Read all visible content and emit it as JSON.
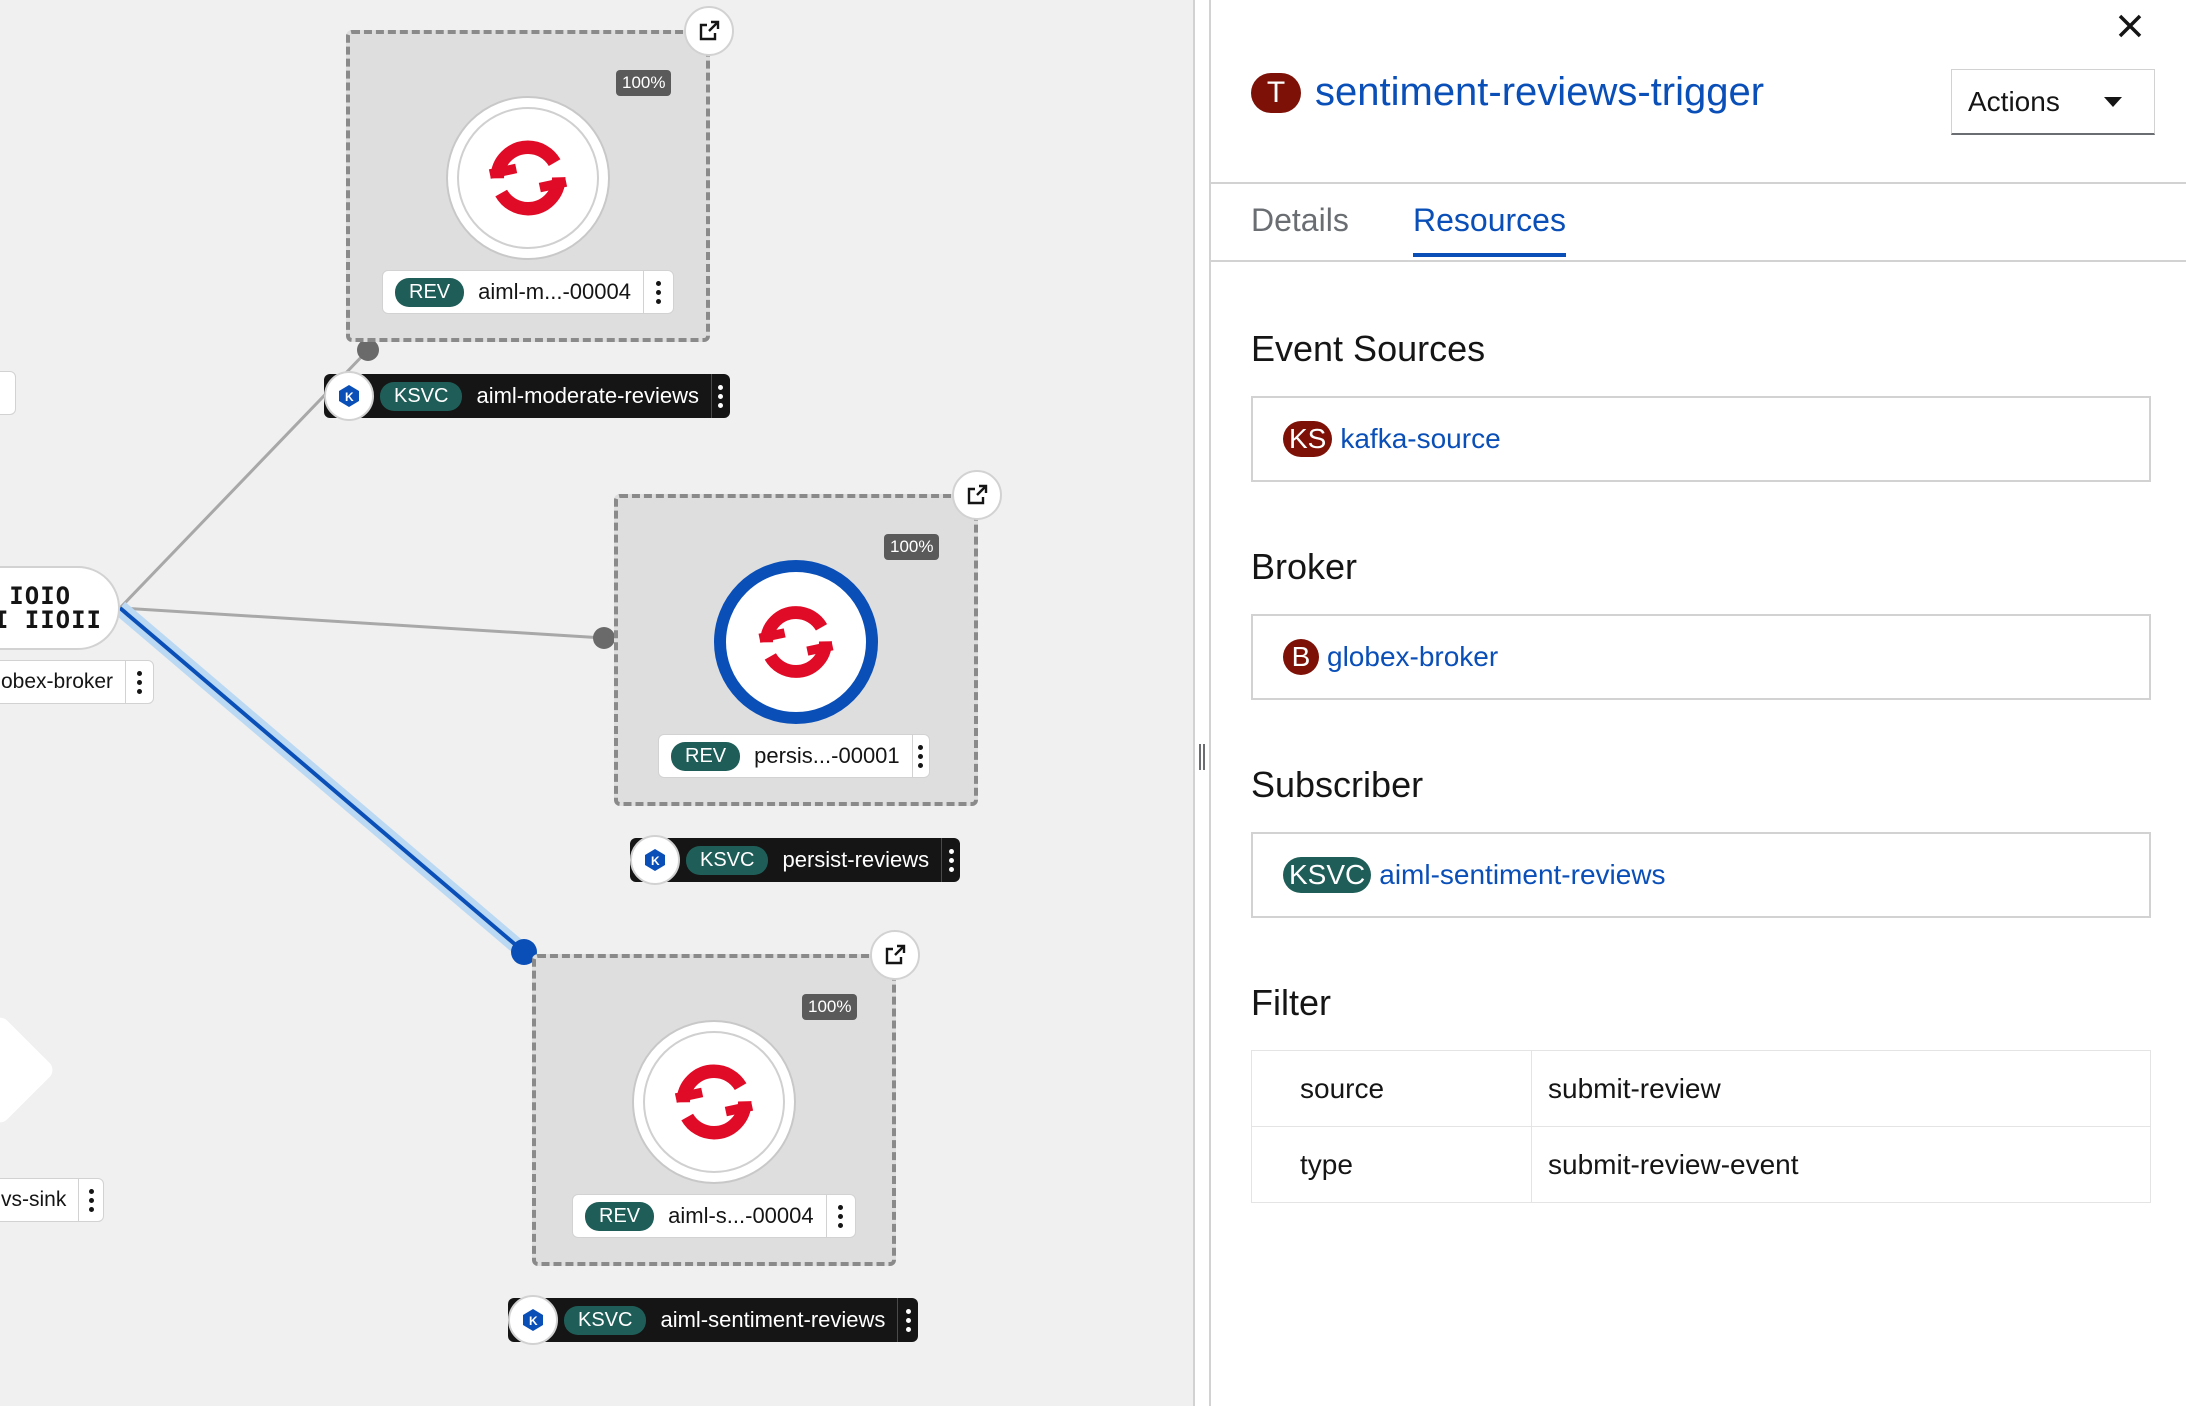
{
  "topology": {
    "groups": [
      {
        "id": "aiml-moderate",
        "traffic": "100%",
        "rev_tag": "REV",
        "rev_name": "aiml-m...-00004",
        "ksvc_tag": "KSVC",
        "ksvc_name": "aiml-moderate-reviews",
        "selected": false
      },
      {
        "id": "persist",
        "traffic": "100%",
        "rev_tag": "REV",
        "rev_name": "persis...-00001",
        "ksvc_tag": "KSVC",
        "ksvc_name": "persist-reviews",
        "selected": true
      },
      {
        "id": "aiml-sentiment",
        "traffic": "100%",
        "rev_tag": "REV",
        "rev_name": "aiml-s...-00004",
        "ksvc_tag": "KSVC",
        "ksvc_name": "aiml-sentiment-reviews",
        "selected": false
      }
    ],
    "broker": {
      "bits_top": "IO IOIO",
      "bits_bottom": "OII IIOII",
      "label": "obex-broker"
    },
    "sink": {
      "label": "vs-sink"
    },
    "colors": {
      "selected_edge": "#0a4fb8",
      "edge": "#a8a8a8",
      "revision_icon": "#e00b26"
    }
  },
  "panel": {
    "close_icon": "close-icon",
    "title_badge": "T",
    "title": "sentiment-reviews-trigger",
    "actions_label": "Actions",
    "tabs": [
      {
        "label": "Details",
        "active": false
      },
      {
        "label": "Resources",
        "active": true
      }
    ],
    "event_sources": {
      "heading": "Event Sources",
      "badge": "KS",
      "name": "kafka-source"
    },
    "broker": {
      "heading": "Broker",
      "badge": "B",
      "name": "globex-broker"
    },
    "subscriber": {
      "heading": "Subscriber",
      "badge": "KSVC",
      "name": "aiml-sentiment-reviews"
    },
    "filter": {
      "heading": "Filter",
      "rows": [
        {
          "key": "source",
          "value": "submit-review"
        },
        {
          "key": "type",
          "value": "submit-review-event"
        }
      ]
    },
    "colors": {
      "accent": "#0a4fb8",
      "badge_red": "#7d1007",
      "badge_teal": "#1f5e58"
    }
  }
}
